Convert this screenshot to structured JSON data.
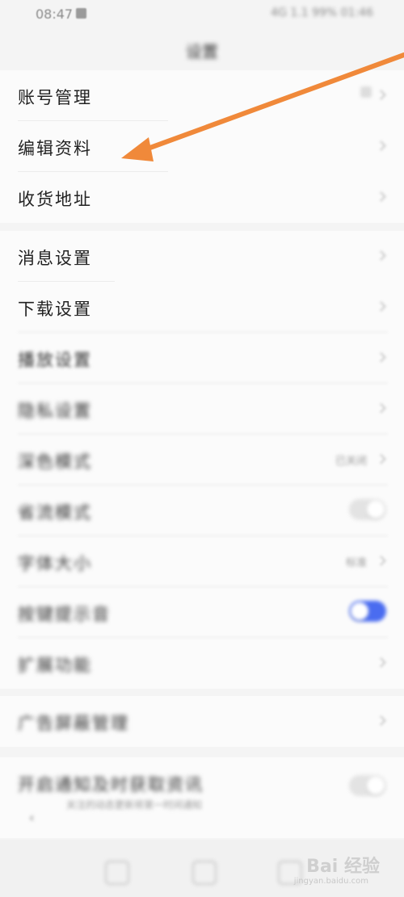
{
  "status_bar": {
    "time": "08:47",
    "alarm_icon": "alarm-icon",
    "right_indicators": "4G 1.1 99% 01:46"
  },
  "header": {
    "title": "设置"
  },
  "group_account": {
    "items": [
      {
        "label": "账号管理"
      },
      {
        "label": "编辑资料"
      },
      {
        "label": "收货地址"
      }
    ]
  },
  "group_settings": {
    "items": [
      {
        "label": "消息设置"
      },
      {
        "label": "下载设置"
      },
      {
        "label": "播放设置"
      },
      {
        "label": "隐私设置"
      },
      {
        "label": "深色模式",
        "value": "已关闭"
      },
      {
        "label": "省流模式"
      },
      {
        "label": "字体大小",
        "value": "标准"
      },
      {
        "label": "按键提示音",
        "toggle_on": true
      },
      {
        "label": "扩展功能"
      }
    ]
  },
  "group_ads": {
    "items": [
      {
        "label": "广告屏蔽管理"
      }
    ]
  },
  "group_notify": {
    "items": [
      {
        "label": "开启通知及时获取资讯",
        "sub": "关注的动态更新将第一时间通知"
      }
    ]
  },
  "annotation": {
    "arrow_color": "#f0893a"
  },
  "watermark": {
    "brand": "Bai 经验",
    "sub": "jingyan.baidu.com"
  }
}
